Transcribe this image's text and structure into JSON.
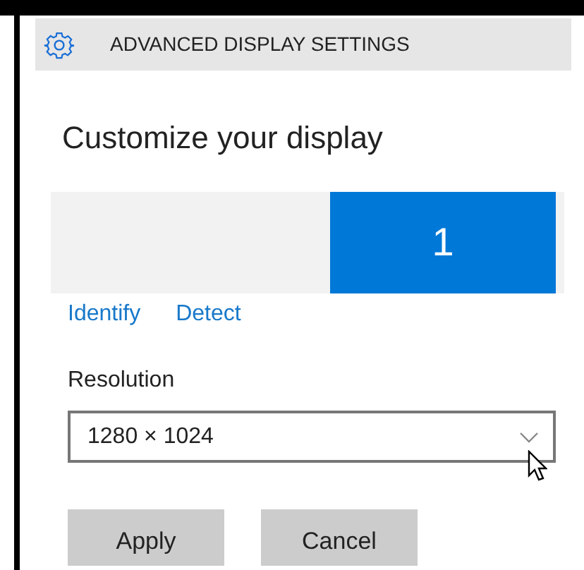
{
  "header": {
    "title": "ADVANCED DISPLAY SETTINGS"
  },
  "heading": "Customize your display",
  "monitors": [
    {
      "label": "1",
      "selected": true
    }
  ],
  "links": [
    "Identify",
    "Detect"
  ],
  "resolution": {
    "label": "Resolution",
    "value": "1280 × 1024"
  },
  "buttons": [
    "Apply",
    "Cancel"
  ]
}
